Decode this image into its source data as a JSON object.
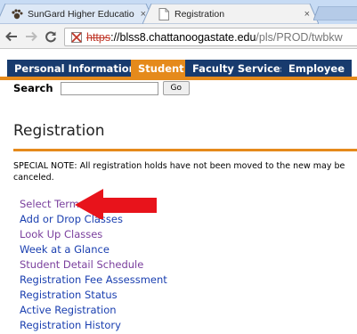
{
  "browser": {
    "tabs": [
      {
        "title": "SunGard Higher Educatio",
        "close": "×"
      },
      {
        "title": "Registration",
        "close": "×"
      }
    ],
    "url": {
      "scheme": "https",
      "host": "://blss8.chattanoogastate.edu",
      "path": "/pls/PROD/twbkw"
    }
  },
  "nav": {
    "tabs": [
      {
        "label": "Personal Information"
      },
      {
        "label": "Student"
      },
      {
        "label": "Faculty Services"
      },
      {
        "label": "Employee"
      }
    ],
    "search_label": "Search",
    "search_value": "",
    "go_label": "Go"
  },
  "page": {
    "title": "Registration",
    "note": "SPECIAL NOTE: All registration holds have not been moved to the new may be canceled."
  },
  "menu": [
    {
      "label": "Select Term",
      "color": "#7a3f9d"
    },
    {
      "label": "Add or Drop Classes",
      "color": "#1a3fb0"
    },
    {
      "label": "Look Up Classes",
      "color": "#7a3f9d"
    },
    {
      "label": "Week at a Glance",
      "color": "#1a3fb0"
    },
    {
      "label": "Student Detail Schedule",
      "color": "#7a3f9d"
    },
    {
      "label": "Registration Fee Assessment",
      "color": "#1a3fb0"
    },
    {
      "label": "Registration Status",
      "color": "#1a3fb0"
    },
    {
      "label": "Active Registration",
      "color": "#1a3fb0"
    },
    {
      "label": "Registration History",
      "color": "#1a3fb0"
    }
  ],
  "colors": {
    "accent": "#e58a1b",
    "banner_blue": "#183b6e",
    "annotation_arrow": "#e8131b"
  },
  "icons": [
    "paw-icon",
    "page-icon",
    "back-arrow-icon",
    "forward-arrow-icon",
    "reload-icon",
    "lock-broken-icon",
    "red-arrow-annotation"
  ]
}
